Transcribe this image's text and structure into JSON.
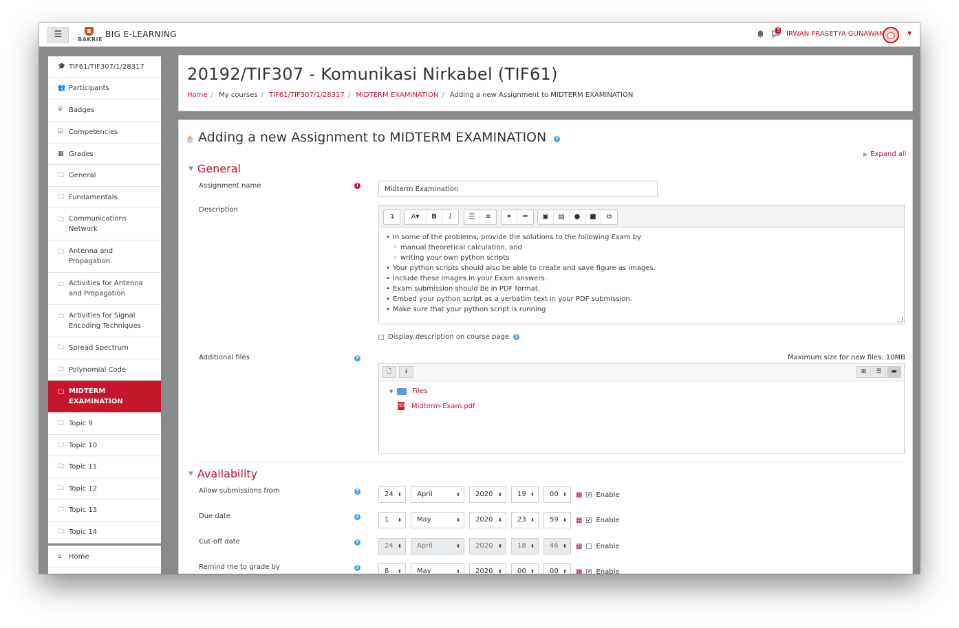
{
  "navbar": {
    "site_name": "BIG E-LEARNING",
    "logo_text": "BAKRIE",
    "logo_mark": "B",
    "message_count": "3",
    "user_name": "IRWAN PRASETYA GUNAWAN"
  },
  "sidebar": {
    "items": [
      {
        "label": "TIF61/TIF307/1/28317",
        "icon": "graduation-cap-icon"
      },
      {
        "label": "Participants",
        "icon": "users-icon"
      },
      {
        "label": "Badges",
        "icon": "shield-icon"
      },
      {
        "label": "Competencies",
        "icon": "check-square-icon"
      },
      {
        "label": "Grades",
        "icon": "table-icon"
      },
      {
        "label": "General",
        "icon": "folder-icon"
      },
      {
        "label": "Fundamentals",
        "icon": "folder-icon"
      },
      {
        "label": "Communications Network",
        "icon": "folder-icon"
      },
      {
        "label": "Antenna and Propagation",
        "icon": "folder-icon"
      },
      {
        "label": "Activities for Antenna and Propagation",
        "icon": "folder-icon"
      },
      {
        "label": "Activities for Signal Encoding Techniques",
        "icon": "folder-icon"
      },
      {
        "label": "Spread Spectrum",
        "icon": "folder-icon"
      },
      {
        "label": "Polynomial Code",
        "icon": "folder-icon"
      },
      {
        "label": "MIDTERM EXAMINATION",
        "icon": "folder-icon",
        "active": true
      },
      {
        "label": "Topic 9",
        "icon": "folder-icon"
      },
      {
        "label": "Topic 10",
        "icon": "folder-icon"
      },
      {
        "label": "Topic 11",
        "icon": "folder-icon"
      },
      {
        "label": "Topic 12",
        "icon": "folder-icon"
      },
      {
        "label": "Topic 13",
        "icon": "folder-icon"
      },
      {
        "label": "Topic 14",
        "icon": "folder-icon"
      },
      {
        "label": "Home",
        "icon": "home-icon"
      }
    ]
  },
  "header": {
    "title": "20192/TIF307 - Komunikasi Nirkabel (TIF61)",
    "breadcrumb": [
      "Home",
      "My courses",
      "TIF61/TIF307/1/28317",
      "MIDTERM EXAMINATION",
      "Adding a new Assignment to MIDTERM EXAMINATION"
    ]
  },
  "form": {
    "title": "Adding a new Assignment to MIDTERM EXAMINATION",
    "expand_all": "Expand all",
    "general": {
      "heading": "General",
      "assignment_name_label": "Assignment name",
      "assignment_name_value": "Midterm Examination",
      "description_label": "Description",
      "description_items": [
        {
          "text": "In some of the problems, provide the solutions to the following Exam by",
          "level": 0
        },
        {
          "text": "manual theoretical calculation, and",
          "level": 1
        },
        {
          "text": "writing your own python scripts",
          "level": 1
        },
        {
          "text": "Your python scripts should also be able to create and save figure as images.",
          "level": 0
        },
        {
          "text": "Include these images in your Exam answers.",
          "level": 0
        },
        {
          "text": "Exam submission should be in PDF format.",
          "level": 0
        },
        {
          "text": "Embed your python script as a verbatim text in your PDF submission.",
          "level": 0
        },
        {
          "text": "Make sure that your python script is running",
          "level": 0
        }
      ],
      "display_description_label": "Display description on course page",
      "additional_files_label": "Additional files",
      "max_size": "Maximum size for new files: 10MB",
      "folder_name": "Files",
      "file_name": "Midterm-Exam.pdf"
    },
    "availability": {
      "heading": "Availability",
      "rows": [
        {
          "label": "Allow submissions from",
          "day": "24",
          "month": "April",
          "year": "2020",
          "hour": "19",
          "minute": "00",
          "enabled": true,
          "enable_label": "Enable"
        },
        {
          "label": "Due date",
          "day": "1",
          "month": "May",
          "year": "2020",
          "hour": "23",
          "minute": "59",
          "enabled": true,
          "enable_label": "Enable"
        },
        {
          "label": "Cut-off date",
          "day": "24",
          "month": "April",
          "year": "2020",
          "hour": "18",
          "minute": "46",
          "enabled": false,
          "enable_label": "Enable"
        },
        {
          "label": "Remind me to grade by",
          "day": "8",
          "month": "May",
          "year": "2020",
          "hour": "00",
          "minute": "00",
          "enabled": true,
          "enable_label": "Enable"
        }
      ]
    }
  },
  "colors": {
    "brand": "#c8102e",
    "window_bg": "#888a8c",
    "sidebar_active": "#c5162b"
  }
}
